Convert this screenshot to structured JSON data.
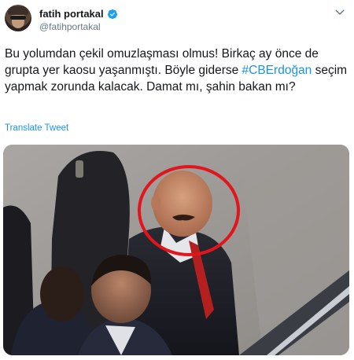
{
  "author": {
    "display_name": "fatih portakal",
    "handle": "@fatihportakal",
    "verified": true
  },
  "tweet": {
    "text_before_hashtag": "Bu yolumdan çekil omuzlaşması olmus! Birkaç ay önce de grupta yer kaosu yaşanmıştı. Böyle giderse ",
    "hashtag": "#CBErdoğan",
    "text_after_hashtag": " seçim yapmak zorunda kalacak. Damat mı, şahin bakan mı?"
  },
  "actions": {
    "translate_label": "Translate Tweet"
  },
  "icons": {
    "verified": "verified-badge-icon",
    "menu": "chevron-down-icon"
  },
  "colors": {
    "link": "#1b95e0",
    "verified": "#1da1f2",
    "secondary_text": "#657786",
    "highlight_circle": "#e2141c"
  }
}
